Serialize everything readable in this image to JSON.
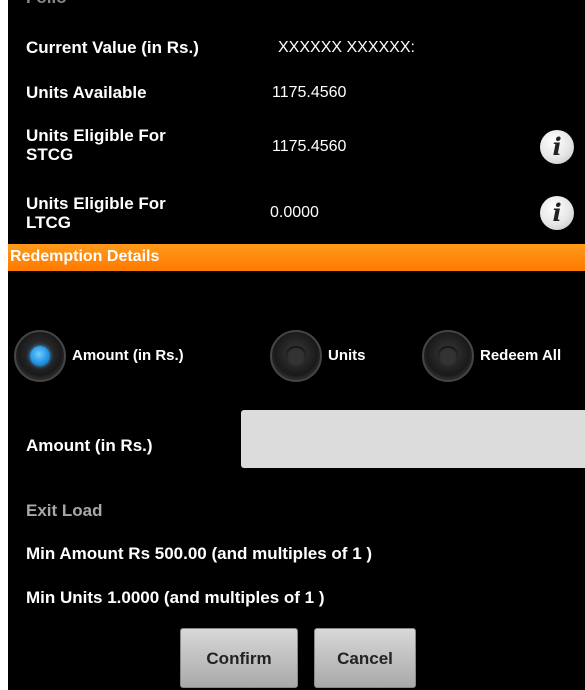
{
  "details": {
    "current_value_label": "Current Value (in Rs.)",
    "current_value": "XXXXXX XXXXXX:",
    "units_available_label": "Units Available",
    "units_available": "1175.4560",
    "stcg_label_line1": "Units Eligible For",
    "stcg_label_line2": "STCG",
    "stcg_value": "1175.4560",
    "ltcg_label_line1": "Units Eligible For",
    "ltcg_label_line2": "LTCG",
    "ltcg_value": "0.0000",
    "info_icon_glyph": "i"
  },
  "section": {
    "title": "Redemption Details",
    "color": "#ff8c00"
  },
  "redeem_options": [
    {
      "label": "Amount (in Rs.)",
      "selected": true
    },
    {
      "label": "Units",
      "selected": false
    },
    {
      "label": "Redeem All",
      "selected": false
    }
  ],
  "form": {
    "amount_label": "Amount (in Rs.)",
    "amount_value": "",
    "exit_load_label": "Exit Load",
    "min_amount_text": "Min Amount Rs 500.00 (and multiples of 1 )",
    "min_units_text": "Min Units 1.0000 (and multiples of 1 )"
  },
  "buttons": {
    "confirm": "Confirm",
    "cancel": "Cancel"
  },
  "colors": {
    "accent": "#ff8c00",
    "selected_radio": "#1e8fe0",
    "background": "#000000"
  }
}
